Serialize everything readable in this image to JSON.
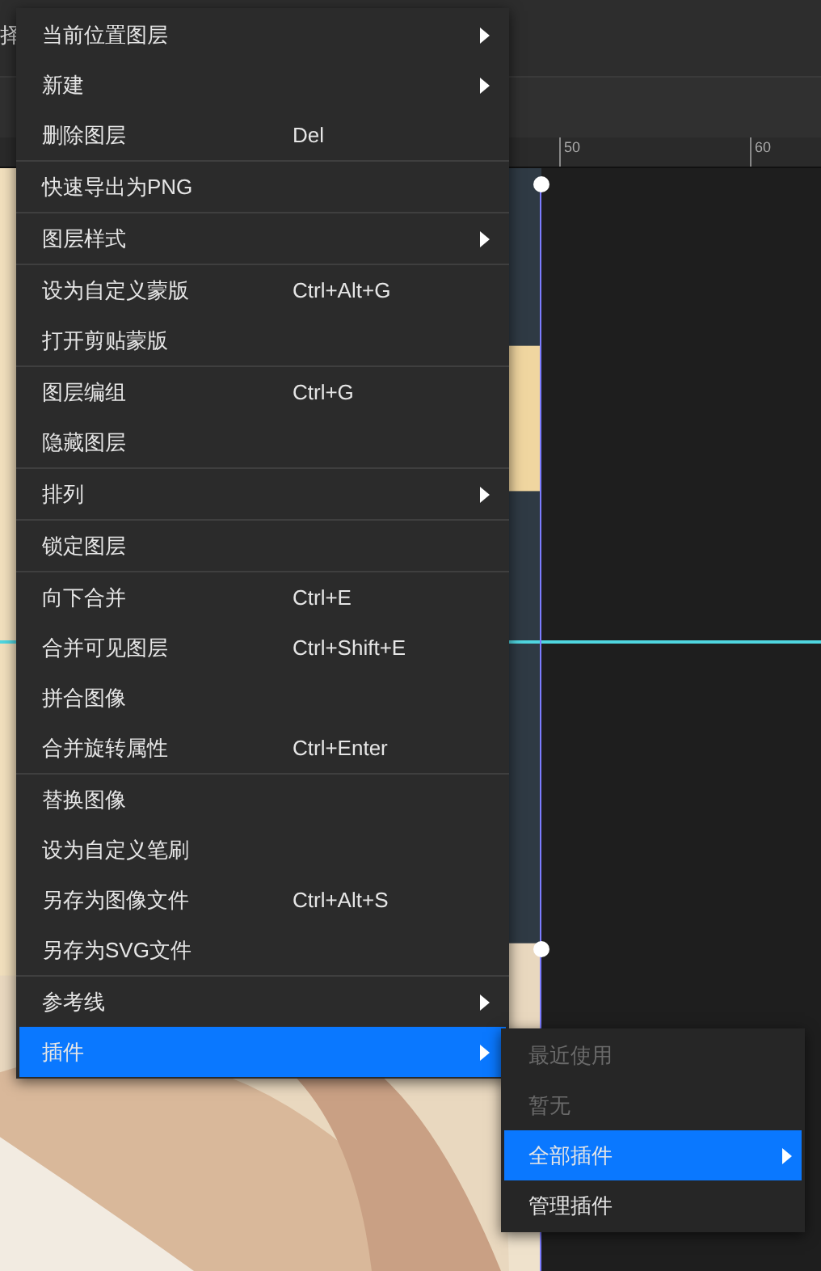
{
  "toolbar": {
    "text": "择"
  },
  "ruler": {
    "labels": [
      "50",
      "60"
    ]
  },
  "context_menu": {
    "sections": [
      [
        {
          "label": "当前位置图层",
          "submenu": true,
          "selected": false
        },
        {
          "label": "新建",
          "submenu": true,
          "selected": false
        },
        {
          "label": "删除图层",
          "shortcut": "Del",
          "submenu": false,
          "selected": false
        }
      ],
      [
        {
          "label": "快速导出为PNG",
          "submenu": false,
          "selected": false
        }
      ],
      [
        {
          "label": "图层样式",
          "submenu": true,
          "selected": false
        }
      ],
      [
        {
          "label": "设为自定义蒙版",
          "shortcut": "Ctrl+Alt+G",
          "submenu": false,
          "selected": false
        },
        {
          "label": "打开剪贴蒙版",
          "submenu": false,
          "selected": false
        }
      ],
      [
        {
          "label": "图层编组",
          "shortcut": "Ctrl+G",
          "submenu": false,
          "selected": false
        },
        {
          "label": "隐藏图层",
          "submenu": false,
          "selected": false
        }
      ],
      [
        {
          "label": "排列",
          "submenu": true,
          "selected": false
        }
      ],
      [
        {
          "label": "锁定图层",
          "submenu": false,
          "selected": false
        }
      ],
      [
        {
          "label": "向下合并",
          "shortcut": "Ctrl+E",
          "submenu": false,
          "selected": false
        },
        {
          "label": "合并可见图层",
          "shortcut": "Ctrl+Shift+E",
          "submenu": false,
          "selected": false
        },
        {
          "label": "拼合图像",
          "submenu": false,
          "selected": false
        },
        {
          "label": "合并旋转属性",
          "shortcut": "Ctrl+Enter",
          "submenu": false,
          "selected": false
        }
      ],
      [
        {
          "label": "替换图像",
          "submenu": false,
          "selected": false
        },
        {
          "label": "设为自定义笔刷",
          "submenu": false,
          "selected": false
        },
        {
          "label": "另存为图像文件",
          "shortcut": "Ctrl+Alt+S",
          "submenu": false,
          "selected": false
        },
        {
          "label": "另存为SVG文件",
          "submenu": false,
          "selected": false
        }
      ],
      [
        {
          "label": "参考线",
          "submenu": true,
          "selected": false
        },
        {
          "label": "插件",
          "submenu": true,
          "selected": true
        }
      ]
    ]
  },
  "submenu": {
    "items": [
      {
        "label": "最近使用",
        "disabled": true,
        "submenu": false,
        "selected": false
      },
      {
        "label": "暂无",
        "disabled": true,
        "submenu": false,
        "selected": false
      },
      {
        "label": "全部插件",
        "disabled": false,
        "submenu": true,
        "selected": true
      },
      {
        "label": "管理插件",
        "disabled": false,
        "submenu": false,
        "selected": false
      }
    ]
  }
}
